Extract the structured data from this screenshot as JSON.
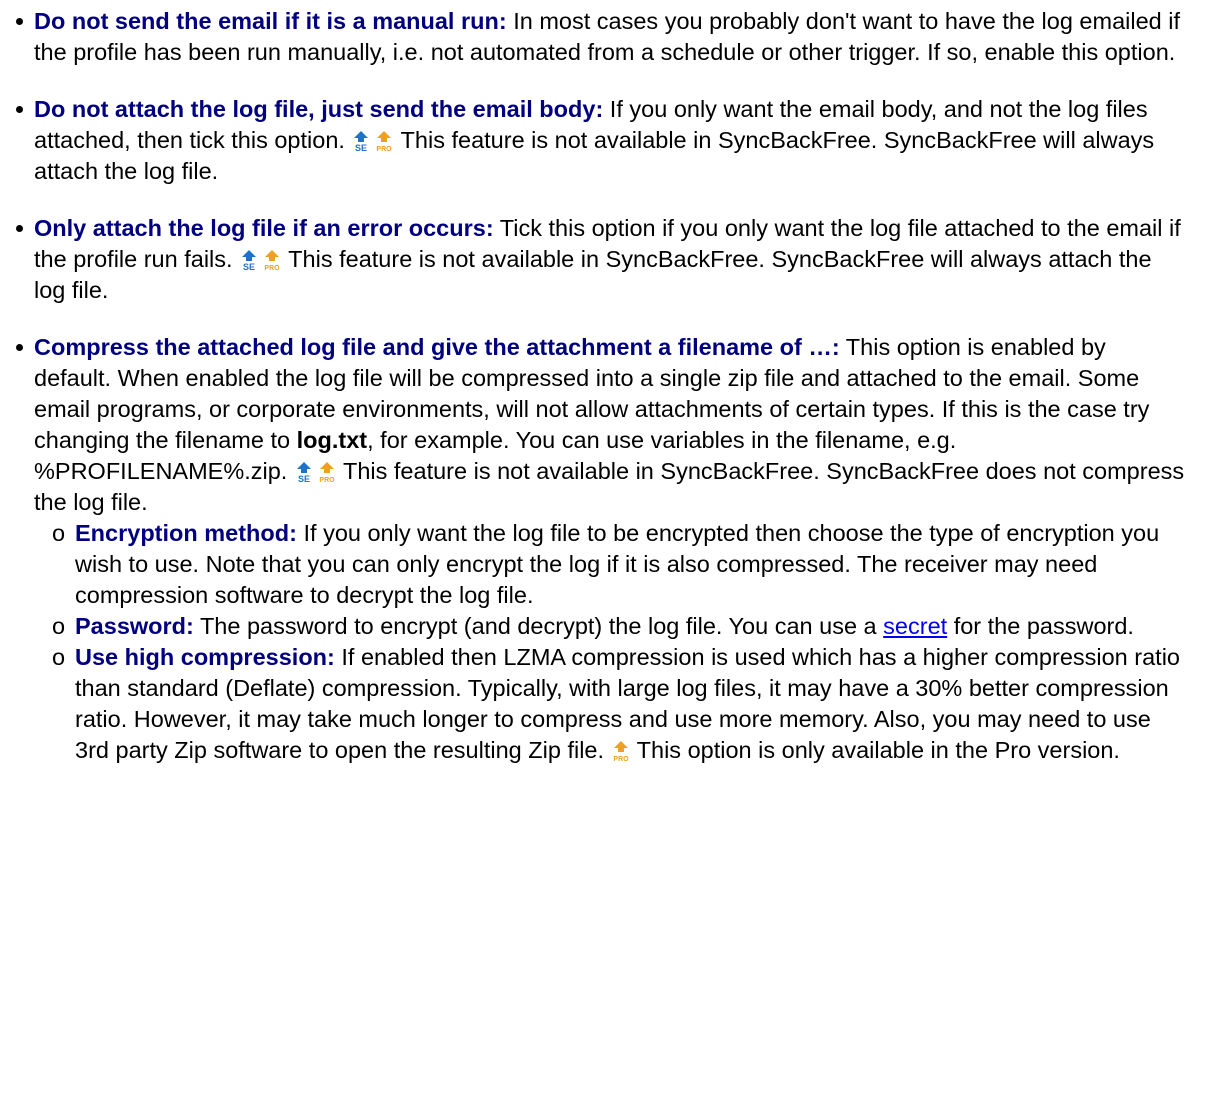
{
  "items": [
    {
      "term": "Do not send the email if it is a manual run:",
      "text": " In most cases you probably don't want to have the log emailed if the profile has been run manually, i.e. not automated from a schedule or other trigger. If so, enable this option."
    },
    {
      "term": "Do not attach the log file, just send the email body:",
      "text_before": " If you only want the email body, and not the log files attached, then tick this option. ",
      "text_after": " This feature is not available in SyncBackFree. SyncBackFree will always attach the log file."
    },
    {
      "term": "Only attach the log file if an error occurs:",
      "text_before": " Tick this option if you only want the log file attached to the email if the profile run fails. ",
      "text_after": " This feature is not available in SyncBackFree. SyncBackFree will always attach the log file."
    },
    {
      "term": "Compress the attached log file and give the attachment a filename of …:",
      "text_before": " This option is enabled by default. When enabled the log file will be compressed into a single zip file and attached to the email. Some email programs, or corporate environments, will not allow attachments of certain types. If this is the case try changing the filename to ",
      "emphasis": "log.txt",
      "text_middle": ", for example. You can use variables in the filename, e.g. %PROFILENAME%.zip. ",
      "text_after": " This feature is not available in SyncBackFree. SyncBackFree does not compress the log file.",
      "subs": [
        {
          "marker": "o",
          "term": "Encryption method:",
          "text": " If you only want the log file to be encrypted then choose the type of encryption you wish to use. Note that you can only encrypt the log if it is also compressed. The receiver may need compression software to decrypt the log file."
        },
        {
          "marker": "o",
          "term": "Password:",
          "text_before": " The password to encrypt (and decrypt) the log file. You can use a ",
          "link": "secret",
          "text_after": " for the password."
        },
        {
          "marker": "o",
          "term": "Use high compression:",
          "text_before": " If enabled then LZMA compression is used which has a higher compression ratio than standard (Deflate) compression. Typically, with large log files, it may have a 30% better compression ratio. However, it may take much longer to compress and use more memory. Also, you may need to use 3rd party Zip software to open the resulting Zip file. ",
          "text_after": " This option is only available in the Pro version."
        }
      ]
    }
  ],
  "icons": {
    "se": "syncback-se-icon",
    "pro": "syncback-pro-icon"
  },
  "colors": {
    "term": "#000080",
    "link": "#0000ee",
    "se_icon": "#1e73c8",
    "pro_icon": "#f0a020"
  }
}
